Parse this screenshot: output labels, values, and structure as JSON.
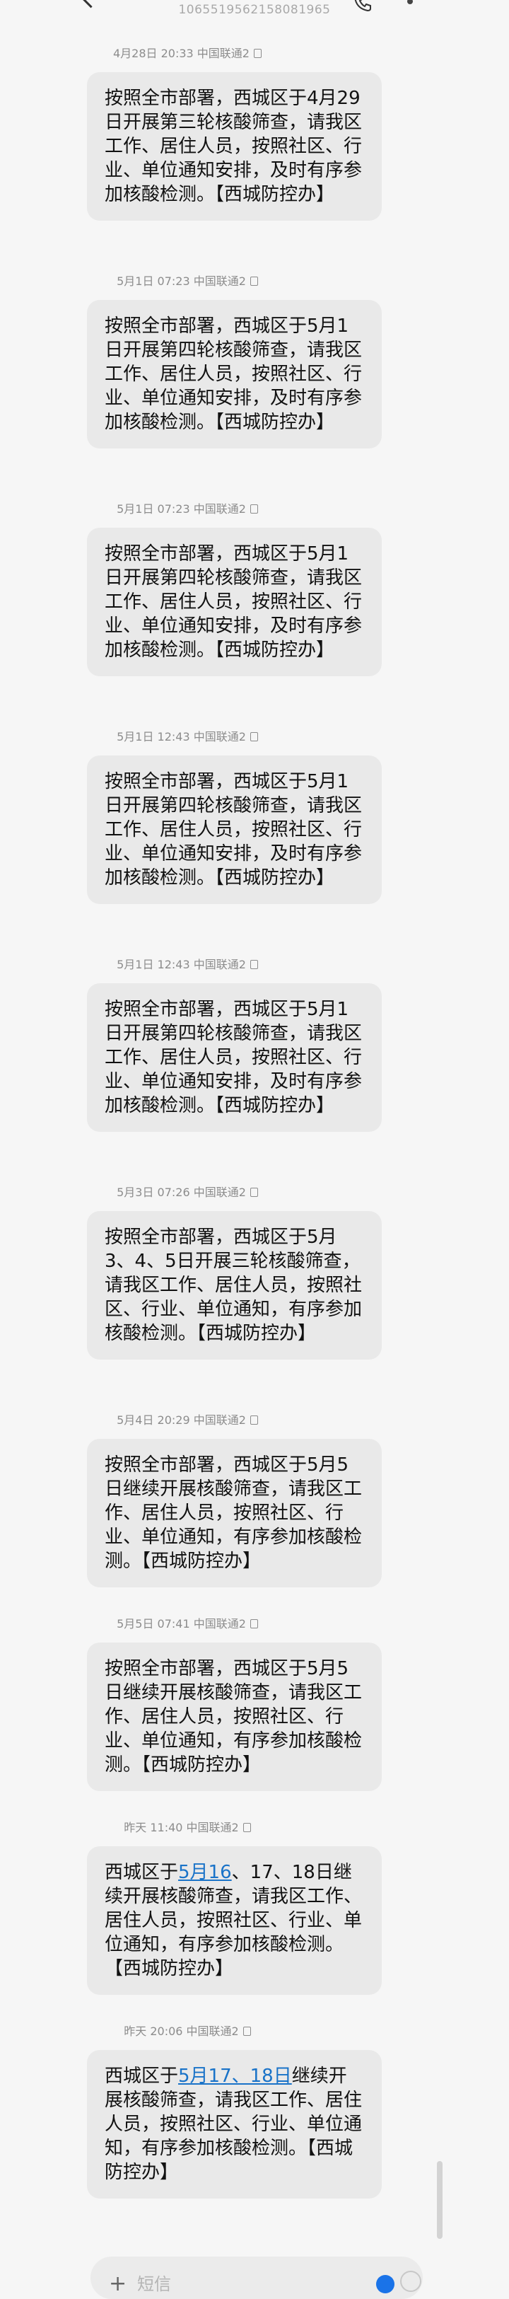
{
  "header": {
    "sender_number": "1065519562158081965"
  },
  "messages": [
    {
      "timestamp": "4月28日 20:33 中国联通2",
      "text": "按照全市部署，西城区于4月29日开展第三轮核酸筛查，请我区工作、居住人员，按照社区、行业、单位通知安排，及时有序参加核酸检测。【西城防控办】"
    },
    {
      "timestamp": "5月1日 07:23 中国联通2",
      "text": "按照全市部署，西城区于5月1日开展第四轮核酸筛查，请我区工作、居住人员，按照社区、行业、单位通知安排，及时有序参加核酸检测。【西城防控办】"
    },
    {
      "timestamp": "5月1日 07:23 中国联通2",
      "text": "按照全市部署，西城区于5月1日开展第四轮核酸筛查，请我区工作、居住人员，按照社区、行业、单位通知安排，及时有序参加核酸检测。【西城防控办】"
    },
    {
      "timestamp": "5月1日 12:43 中国联通2",
      "text": "按照全市部署，西城区于5月1日开展第四轮核酸筛查，请我区工作、居住人员，按照社区、行业、单位通知安排，及时有序参加核酸检测。【西城防控办】"
    },
    {
      "timestamp": "5月1日 12:43 中国联通2",
      "text": "按照全市部署，西城区于5月1日开展第四轮核酸筛查，请我区工作、居住人员，按照社区、行业、单位通知安排，及时有序参加核酸检测。【西城防控办】"
    },
    {
      "timestamp": "5月3日 07:26 中国联通2",
      "text": "按照全市部署，西城区于5月3、4、5日开展三轮核酸筛查，请我区工作、居住人员，按照社区、行业、单位通知，有序参加核酸检测。【西城防控办】"
    },
    {
      "timestamp": "5月4日 20:29 中国联通2",
      "text": "按照全市部署，西城区于5月5日继续开展核酸筛查，请我区工作、居住人员，按照社区、行业、单位通知，有序参加核酸检测。【西城防控办】"
    },
    {
      "timestamp": "5月5日 07:41 中国联通2",
      "text": "按照全市部署，西城区于5月5日继续开展核酸筛查，请我区工作、居住人员，按照社区、行业、单位通知，有序参加核酸检测。【西城防控办】"
    },
    {
      "timestamp": "昨天 11:40 中国联通2",
      "text_before": "西城区于",
      "link": "5月16",
      "text_after": "、17、18日继续开展核酸筛查，请我区工作、居住人员，按照社区、行业、单位通知，有序参加核酸检测。【西城防控办】"
    },
    {
      "timestamp": "昨天 20:06 中国联通2",
      "text_before": "西城区于",
      "link": "5月17、18日",
      "text_after": "继续开展核酸筛查，请我区工作、居住人员，按照社区、行业、单位通知，有序参加核酸检测。【西城防控办】"
    }
  ],
  "composer": {
    "plus": "+",
    "placeholder": "短信"
  },
  "colors": {
    "background": "#f6f6f6",
    "bubble": "#e9e9e9",
    "link": "#1a73c8",
    "timestamp": "#8c8c8c"
  }
}
